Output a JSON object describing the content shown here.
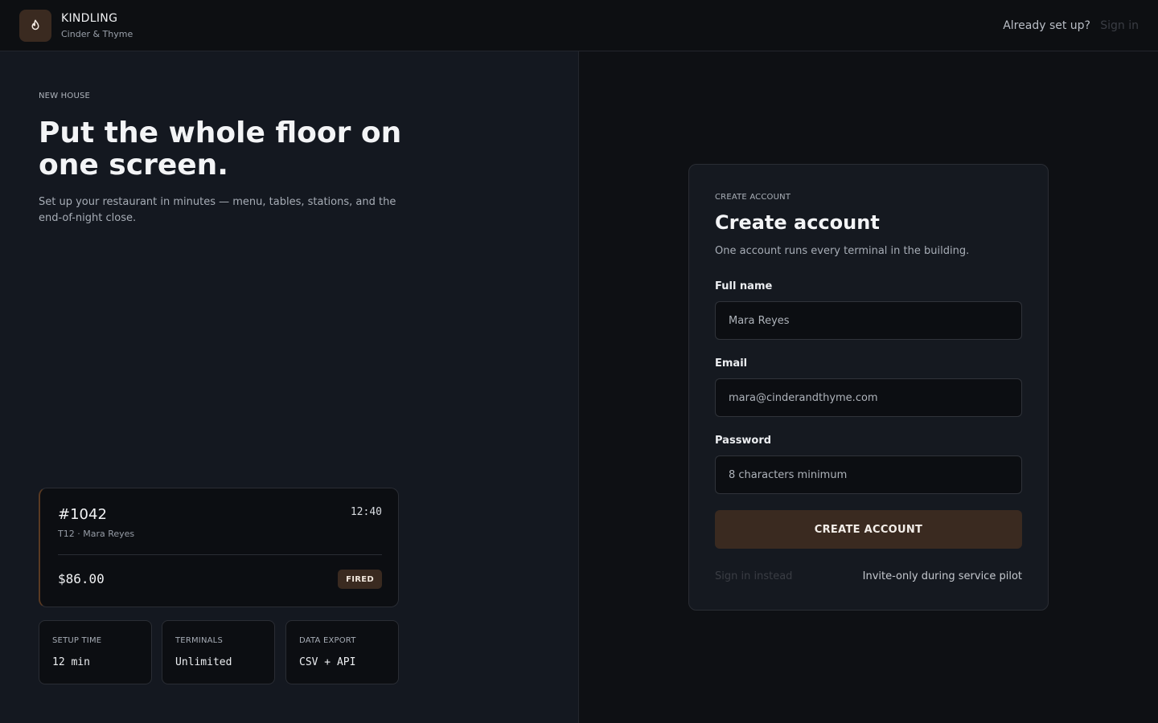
{
  "header": {
    "brand_name": "KINDLING",
    "brand_sub": "Cinder & Thyme",
    "logo_icon": "flame-icon",
    "prompt_text": "Already set up?",
    "sign_in_label": "Sign in"
  },
  "hero": {
    "eyebrow": "NEW HOUSE",
    "title": "Put the whole floor on one screen.",
    "description": "Set up your restaurant in minutes — menu, tables, stations, and the end-of-night close."
  },
  "ticket": {
    "number": "#1042",
    "time": "12:40",
    "meta": "T12 · Mara Reyes",
    "amount": "$86.00",
    "status": "FIRED"
  },
  "stats": [
    {
      "label": "SETUP TIME",
      "value": "12 min"
    },
    {
      "label": "TERMINALS",
      "value": "Unlimited"
    },
    {
      "label": "DATA EXPORT",
      "value": "CSV + API"
    }
  ],
  "form": {
    "eyebrow": "CREATE ACCOUNT",
    "title": "Create account",
    "description": "One account runs every terminal in the building.",
    "full_name": {
      "label": "Full name",
      "placeholder": "Mara Reyes"
    },
    "email": {
      "label": "Email",
      "placeholder": "mara@cinderandthyme.com"
    },
    "password": {
      "label": "Password",
      "placeholder": "8 characters minimum"
    },
    "submit_label": "CREATE ACCOUNT",
    "sign_in_link": "Sign in instead",
    "footnote": "Invite-only during service pilot"
  },
  "colors": {
    "accent": "#3a2a20",
    "background": "#0e1014",
    "panel": "#141820"
  }
}
